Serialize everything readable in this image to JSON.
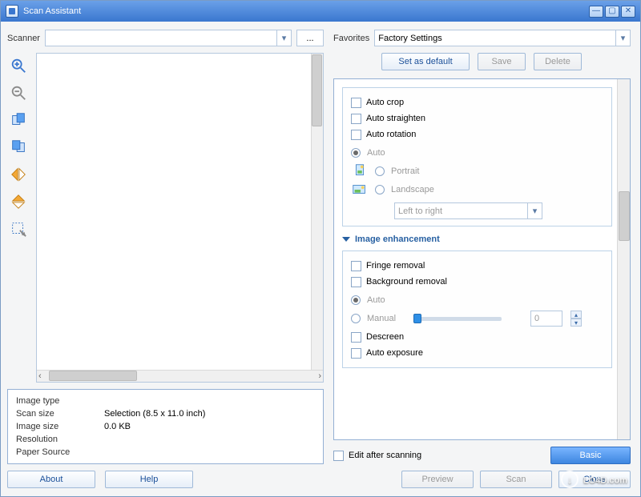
{
  "window": {
    "title": "Scan Assistant"
  },
  "scanner": {
    "label": "Scanner",
    "value": "",
    "ellipsis": "..."
  },
  "toolbar_icons": [
    "zoom-in",
    "zoom-out",
    "rotate-left",
    "rotate-right",
    "mirror-horizontal",
    "mirror-vertical",
    "crop-select"
  ],
  "info": {
    "image_type_k": "Image type",
    "image_type_v": "",
    "scan_size_k": "Scan size",
    "scan_size_v": "Selection (8.5 x 11.0 inch)",
    "image_size_k": "Image size",
    "image_size_v": "0.0 KB",
    "resolution_k": "Resolution",
    "resolution_v": "",
    "paper_source_k": "Paper Source",
    "paper_source_v": ""
  },
  "buttons": {
    "about": "About",
    "help": "Help",
    "set_default": "Set as default",
    "save": "Save",
    "delete": "Delete",
    "preview": "Preview",
    "scan": "Scan",
    "close": "Close",
    "basic": "Basic"
  },
  "favorites": {
    "label": "Favorites",
    "value": "Factory Settings"
  },
  "options": {
    "auto_crop": "Auto crop",
    "auto_straighten": "Auto straighten",
    "auto_rotation": "Auto rotation",
    "auto": "Auto",
    "portrait": "Portrait",
    "landscape": "Landscape",
    "left_to_right": "Left to right",
    "section": "Image enhancement",
    "fringe": "Fringe removal",
    "background": "Background removal",
    "manual": "Manual",
    "manual_val": "0",
    "descreen": "Descreen",
    "auto_exposure": "Auto exposure",
    "edit_after": "Edit after scanning"
  },
  "watermark": "LO4D.com"
}
